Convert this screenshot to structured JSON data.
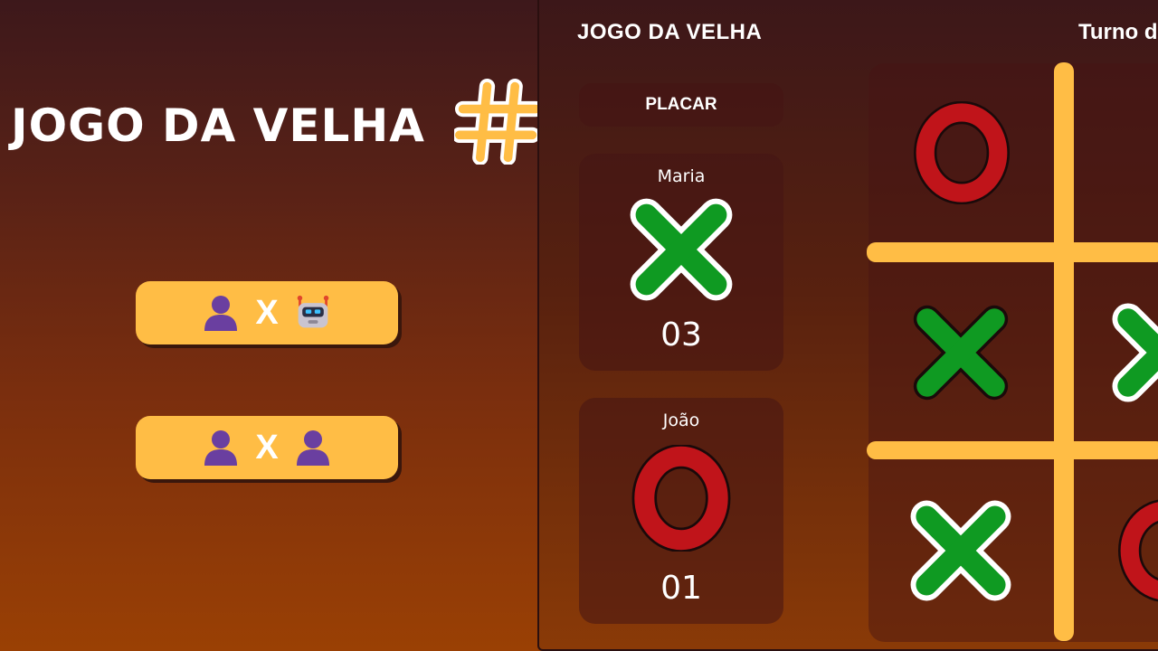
{
  "menu": {
    "title": "JOGO DA VELHA",
    "hash_icon": "hash-icon",
    "buttons": [
      {
        "left_icon": "person-icon",
        "separator": "X",
        "right_icon": "robot-icon"
      },
      {
        "left_icon": "person-icon",
        "separator": "X",
        "right_icon": "person-icon"
      }
    ]
  },
  "game": {
    "title": "JOGO DA VELHA",
    "turn_label": "Turno d",
    "scoreboard": {
      "label": "PLACAR",
      "players": [
        {
          "name": "Maria",
          "mark": "X",
          "score": "03"
        },
        {
          "name": "João",
          "mark": "O",
          "score": "01"
        }
      ]
    },
    "board": {
      "cells": [
        "O",
        "",
        "X",
        "X",
        "X",
        "O"
      ]
    }
  },
  "colors": {
    "accent": "#ffbd45",
    "x_mark": "#0f9a22",
    "o_mark": "#c0141a",
    "text": "#ffffff"
  }
}
